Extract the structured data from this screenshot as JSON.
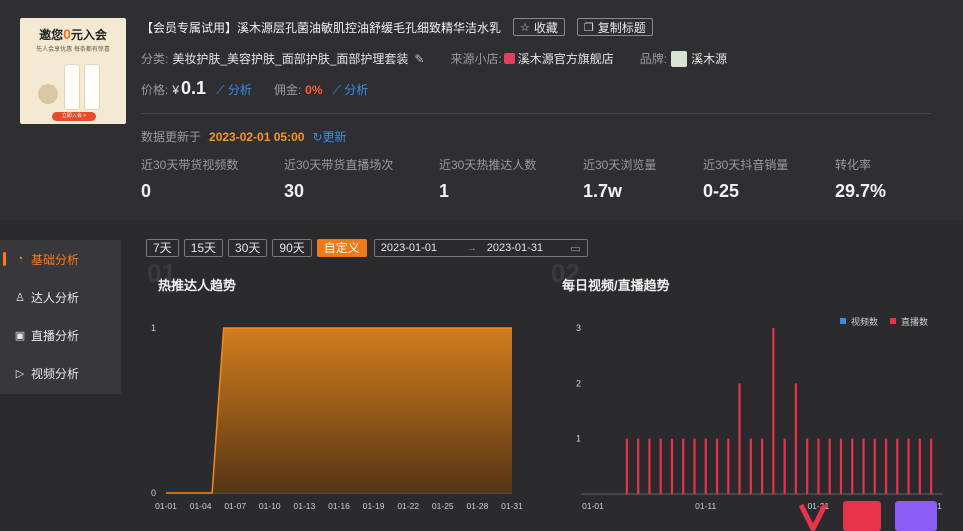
{
  "product": {
    "thumbnail": {
      "headline_prefix": "邀您",
      "headline_highlight": "0",
      "headline_suffix": "元入会",
      "subline": "先人会享优惠 每条都有惊喜",
      "cta": "立即入会 >"
    },
    "title": "【会员专属试用】溪木源层孔菌油敏肌控油舒缓毛孔细致精华洁水乳",
    "favorite_label": "收藏",
    "copy_title_label": "复制标题",
    "category_label": "分类:",
    "category_value": "美妆护肤_美容护肤_面部护肤_面部护理套装",
    "shop_label": "来源小店:",
    "shop_value": "溪木源官方旗舰店",
    "brand_label": "品牌:",
    "brand_value": "溪木源",
    "price_label": "价格:",
    "price_currency": "¥",
    "price_value": "0.1",
    "analysis_label": "分析",
    "commission_label": "佣金:",
    "commission_value": "0%"
  },
  "update": {
    "label": "数据更新于",
    "time": "2023-02-01 05:00",
    "refresh_label": "更新"
  },
  "stats": [
    {
      "label": "近30天带货视频数",
      "value": "0"
    },
    {
      "label": "近30天带货直播场次",
      "value": "30"
    },
    {
      "label": "近30天热推达人数",
      "value": "1"
    },
    {
      "label": "近30天浏览量",
      "value": "1.7w"
    },
    {
      "label": "近30天抖音销量",
      "value": "0-25"
    },
    {
      "label": "转化率",
      "value": "29.7%"
    }
  ],
  "nav": [
    {
      "label": "基础分析",
      "icon": "chart-circle-icon",
      "active": true
    },
    {
      "label": "达人分析",
      "icon": "user-icon",
      "active": false
    },
    {
      "label": "直播分析",
      "icon": "live-icon",
      "active": false
    },
    {
      "label": "视频分析",
      "icon": "play-icon",
      "active": false
    }
  ],
  "date_filter": {
    "options": [
      "7天",
      "15天",
      "30天",
      "90天",
      "自定义"
    ],
    "active": "自定义",
    "start": "2023-01-01",
    "end": "2023-01-31"
  },
  "charts": {
    "left_title": "热推达人趋势",
    "left_index": "01",
    "right_title": "每日视频/直播趋势",
    "right_index": "02"
  },
  "chart_data": [
    {
      "type": "area",
      "title": "热推达人趋势",
      "x_ticks": [
        "01-01",
        "01-04",
        "01-07",
        "01-10",
        "01-13",
        "01-16",
        "01-19",
        "01-22",
        "01-25",
        "01-28",
        "01-31"
      ],
      "ylim": [
        0,
        1
      ],
      "y_ticks": [
        "0",
        "1"
      ],
      "color": "#f08a1a",
      "series": [
        {
          "x": [
            "01-01",
            "01-02",
            "01-03",
            "01-04",
            "01-05",
            "01-06",
            "01-07",
            "01-08",
            "01-09",
            "01-10",
            "01-11",
            "01-12",
            "01-13",
            "01-14",
            "01-15",
            "01-16",
            "01-17",
            "01-18",
            "01-19",
            "01-20",
            "01-21",
            "01-22",
            "01-23",
            "01-24",
            "01-25",
            "01-26",
            "01-27",
            "01-28",
            "01-29",
            "01-30",
            "01-31"
          ],
          "values": [
            0,
            0,
            0,
            0,
            0,
            1,
            1,
            1,
            1,
            1,
            1,
            1,
            1,
            1,
            1,
            1,
            1,
            1,
            1,
            1,
            1,
            1,
            1,
            1,
            1,
            1,
            1,
            1,
            1,
            1,
            1
          ]
        }
      ]
    },
    {
      "type": "bar",
      "title": "每日视频/直播趋势",
      "categories": [
        "01-01",
        "01-02",
        "01-03",
        "01-04",
        "01-05",
        "01-06",
        "01-07",
        "01-08",
        "01-09",
        "01-10",
        "01-11",
        "01-12",
        "01-13",
        "01-14",
        "01-15",
        "01-16",
        "01-17",
        "01-18",
        "01-19",
        "01-20",
        "01-21",
        "01-22",
        "01-23",
        "01-24",
        "01-25",
        "01-26",
        "01-27",
        "01-28",
        "01-29",
        "01-30",
        "01-31"
      ],
      "x_ticks": [
        "01-01",
        "01-11",
        "01-21",
        "01-31"
      ],
      "ylim": [
        0,
        3
      ],
      "y_ticks": [
        "1",
        "2",
        "3"
      ],
      "legend_position": "top-right",
      "series": [
        {
          "name": "视频数",
          "color": "#3a8de0",
          "values": [
            0,
            0,
            0,
            0,
            0,
            0,
            0,
            0,
            0,
            0,
            0,
            0,
            0,
            0,
            0,
            0,
            0,
            0,
            0,
            0,
            0,
            0,
            0,
            0,
            0,
            0,
            0,
            0,
            0,
            0,
            0
          ]
        },
        {
          "name": "直播数",
          "color": "#e8334a",
          "values": [
            0,
            0,
            0,
            1,
            1,
            1,
            1,
            1,
            1,
            1,
            1,
            1,
            1,
            2,
            1,
            1,
            3,
            1,
            2,
            1,
            1,
            1,
            1,
            1,
            1,
            1,
            1,
            1,
            1,
            1,
            1
          ]
        }
      ]
    }
  ]
}
